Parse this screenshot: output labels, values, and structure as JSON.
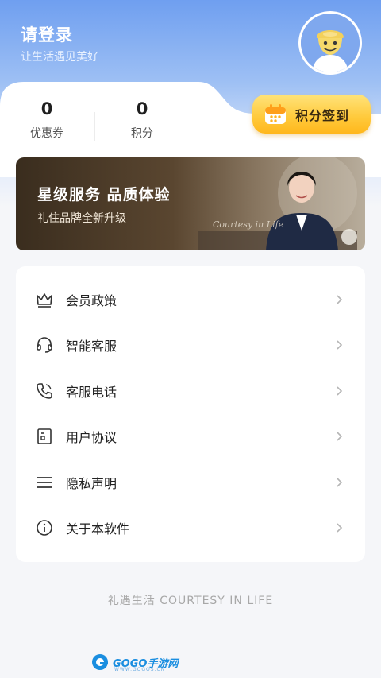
{
  "header": {
    "title": "请登录",
    "subtitle": "让生活遇见美好",
    "accent": "#7aa4ec"
  },
  "stats": {
    "coupons": {
      "value": "0",
      "label": "优惠券"
    },
    "points": {
      "value": "0",
      "label": "积分"
    }
  },
  "checkin": {
    "label": "积分签到",
    "icon": "calendar-icon",
    "color": "#ffc93a"
  },
  "banner": {
    "title": "星级服务 品质体验",
    "subtitle": "礼住品牌全新升级",
    "watermark_script": "Courtesy in Life"
  },
  "menu": {
    "items": [
      {
        "label": "会员政策",
        "icon": "crown-icon"
      },
      {
        "label": "智能客服",
        "icon": "headset-icon"
      },
      {
        "label": "客服电话",
        "icon": "phone-icon"
      },
      {
        "label": "用户协议",
        "icon": "document-icon"
      },
      {
        "label": "隐私声明",
        "icon": "list-icon"
      },
      {
        "label": "关于本软件",
        "icon": "info-icon"
      }
    ]
  },
  "footer": {
    "text": "礼遇生活 COURTESY IN LIFE"
  },
  "watermark": {
    "brand": "GOGO手游网",
    "sub": "WWW.GOGOS.CN"
  }
}
